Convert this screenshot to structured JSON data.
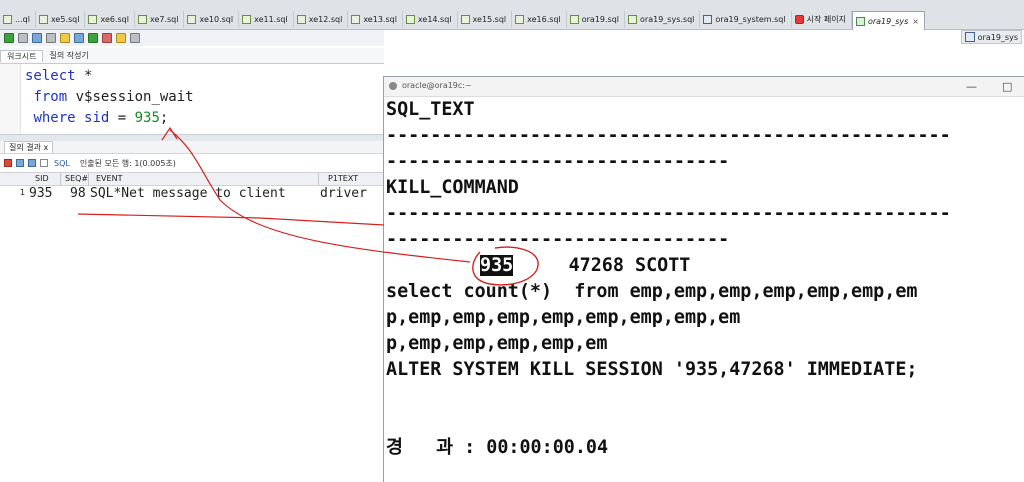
{
  "tabs": [
    {
      "label": "...ql",
      "icon": "sql-file-icon"
    },
    {
      "label": "xe5.sql",
      "icon": "sql-file-icon"
    },
    {
      "label": "xe6.sql",
      "icon": "sql-file-icon"
    },
    {
      "label": "xe7.sql",
      "icon": "sql-file-icon"
    },
    {
      "label": "xe10.sql",
      "icon": "sql-file-icon"
    },
    {
      "label": "xe11.sql",
      "icon": "sql-file-icon"
    },
    {
      "label": "xe12.sql",
      "icon": "sql-file-icon"
    },
    {
      "label": "xe13.sql",
      "icon": "sql-file-icon"
    },
    {
      "label": "xe14.sql",
      "icon": "sql-file-icon"
    },
    {
      "label": "xe15.sql",
      "icon": "sql-file-icon"
    },
    {
      "label": "xe16.sql",
      "icon": "sql-file-icon"
    },
    {
      "label": "ora19.sql",
      "icon": "sql-file-icon"
    },
    {
      "label": "ora19_sys.sql",
      "icon": "sql-file-icon"
    },
    {
      "label": "ora19_system.sql",
      "icon": "database-icon"
    },
    {
      "label": "시작 페이지",
      "icon": "start-page-icon"
    },
    {
      "label": "ora19_sys",
      "icon": "connection-icon",
      "active": true
    }
  ],
  "sub_tab": {
    "label": "ora19_sys"
  },
  "worksheet_tabs": {
    "worksheet": "워크시트",
    "query_builder": "질의 작성기"
  },
  "editor": {
    "line1_kw": "select",
    "line1_rest": " *",
    "line2_kw": "from",
    "line2_rest": " v$session_wait",
    "line3_kw1": "where",
    "line3_kw2": "sid",
    "line3_op": " = ",
    "line3_num": "935",
    "line3_end": ";"
  },
  "results": {
    "tab_label": "질의 결과",
    "tab_close": "x",
    "sql_label": "SQL",
    "status": "인출된 모든 행: 1(0.005초)",
    "columns": [
      "SID",
      "SEQ#",
      "EVENT",
      "P1TEXT"
    ],
    "row": {
      "num": "1",
      "sid": "935",
      "seq": "98",
      "event": "SQL*Net message to client",
      "p1text": "driver"
    }
  },
  "terminal": {
    "title": "oracle@ora19c:~",
    "lines": [
      "SQL_TEXT",
      "---------------------------------------------------",
      "-------------------------------",
      "KILL_COMMAND",
      "---------------------------------------------------",
      "-------------------------------",
      "",
      "select count(*)  from emp,emp,emp,emp,emp,emp,em",
      "p,emp,emp,emp,emp,emp,emp,emp,em",
      "p,emp,emp,emp,emp,em",
      "ALTER SYSTEM KILL SESSION '935,47268' IMMEDIATE;",
      "",
      "",
      "경   과 : 00:00:00.04"
    ],
    "sid_highlight": "935",
    "serial_user": "     47268 SCOTT"
  }
}
